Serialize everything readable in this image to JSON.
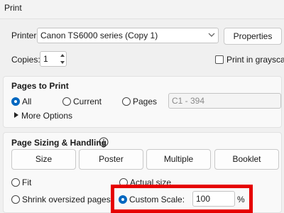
{
  "window": {
    "title": "Print"
  },
  "printer": {
    "label": "Printer:",
    "selected": "Canon TS6000 series (Copy 1)",
    "properties_label": "Properties"
  },
  "copies": {
    "label": "Copies:",
    "value": "1"
  },
  "grayscale": {
    "label": "Print in grayscale",
    "checked": false
  },
  "pages_to_print": {
    "heading": "Pages to Print",
    "options": [
      "All",
      "Current",
      "Pages"
    ],
    "selected": "All",
    "range_value": "C1 - 394",
    "more_options": "More Options"
  },
  "sizing": {
    "heading": "Page Sizing & Handling",
    "info_icon": "info-icon",
    "buttons": [
      "Size",
      "Poster",
      "Multiple",
      "Booklet"
    ],
    "fit_label": "Fit",
    "actual_size_label": "Actual size",
    "shrink_label": "Shrink oversized pages",
    "custom_scale_label": "Custom Scale:",
    "custom_scale_value": "100",
    "percent": "%",
    "selected": "Custom Scale"
  },
  "colors": {
    "accent": "#0067c0",
    "highlight": "#e60000"
  }
}
